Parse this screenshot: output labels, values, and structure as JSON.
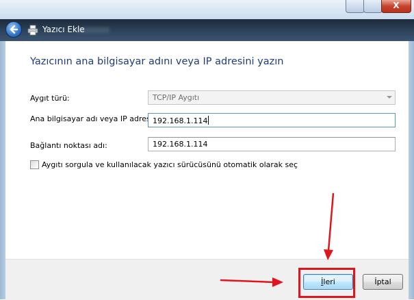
{
  "window": {
    "blurred_title": "",
    "close_glyph": "X"
  },
  "nav": {
    "title": "Yazıcı Ekle",
    "back_icon": "back-arrow-icon",
    "printer_icon": "printer-icon"
  },
  "page": {
    "heading": "Yazıcının ana bilgisayar adını veya IP adresini yazın"
  },
  "form": {
    "device_type_label": "Aygıt türü:",
    "device_type_value": "TCP/IP Aygıtı",
    "host_label": "Ana bilgisayar adı veya IP adresi:",
    "host_value": "192.168.1.114",
    "port_label": "Bağlantı noktası adı:",
    "port_value": "192.168.1.114",
    "query_checkbox_label": "Aygıtı sorgula ve kullanılacak yazıcı sürücüsünü otomatik olarak seç",
    "query_checkbox_checked": false
  },
  "buttons": {
    "next": {
      "underlined": "İ",
      "rest": "leri"
    },
    "cancel": "İptal"
  },
  "colors": {
    "heading": "#1e3c78",
    "annotation": "#e0141d"
  }
}
